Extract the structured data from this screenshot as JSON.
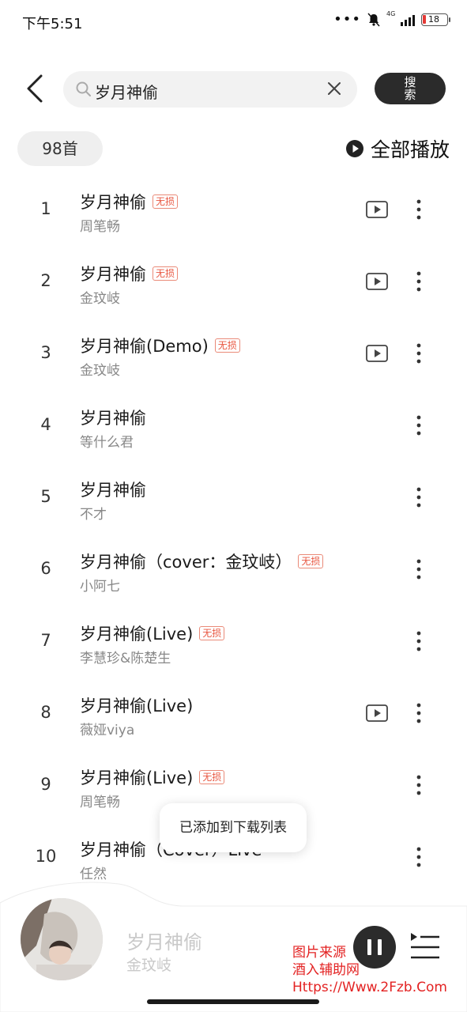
{
  "status_bar": {
    "time": "下午5:51",
    "network": "4G",
    "battery": "18"
  },
  "search": {
    "query": "岁月神偷",
    "button_label": "搜索"
  },
  "toolbar": {
    "count": "98首",
    "play_all_label": "全部播放"
  },
  "songs": [
    {
      "index": "1",
      "title": "岁月神偷",
      "badge": "无损",
      "artist": "周笔畅",
      "mv": true
    },
    {
      "index": "2",
      "title": "岁月神偷",
      "badge": "无损",
      "artist": "金玟岐",
      "mv": true
    },
    {
      "index": "3",
      "title": "岁月神偷(Demo)",
      "badge": "无损",
      "artist": "金玟岐",
      "mv": true
    },
    {
      "index": "4",
      "title": "岁月神偷",
      "badge": "",
      "artist": "等什么君",
      "mv": false
    },
    {
      "index": "5",
      "title": "岁月神偷",
      "badge": "",
      "artist": "不才",
      "mv": false
    },
    {
      "index": "6",
      "title": "岁月神偷（cover：金玟岐）",
      "badge": "无损",
      "artist": "小阿七",
      "mv": false
    },
    {
      "index": "7",
      "title": "岁月神偷(Live)",
      "badge": "无损",
      "artist": "李慧珍&陈楚生",
      "mv": false
    },
    {
      "index": "8",
      "title": "岁月神偷(Live)",
      "badge": "",
      "artist": "薇娅viya",
      "mv": true
    },
    {
      "index": "9",
      "title": "岁月神偷(Live)",
      "badge": "无损",
      "artist": "周笔畅",
      "mv": false
    },
    {
      "index": "10",
      "title": "岁月神偷（Cover）Live",
      "badge": "",
      "artist": "任然",
      "mv": false
    }
  ],
  "toast": "已添加到下载列表",
  "player": {
    "title": "岁月神偷",
    "artist": "金玟岐"
  },
  "watermark": {
    "line1": "图片来源",
    "line2": "酒入辅助网",
    "line3": "Https://Www.2Fzb.Com"
  },
  "colors": {
    "accent_badge": "#e8553f",
    "dark_button": "#2b2b2b",
    "watermark": "#e32222"
  },
  "icons": [
    "back-icon",
    "search-icon",
    "clear-icon",
    "play-circle-icon",
    "mv-icon",
    "more-icon",
    "pause-icon",
    "playlist-icon"
  ]
}
